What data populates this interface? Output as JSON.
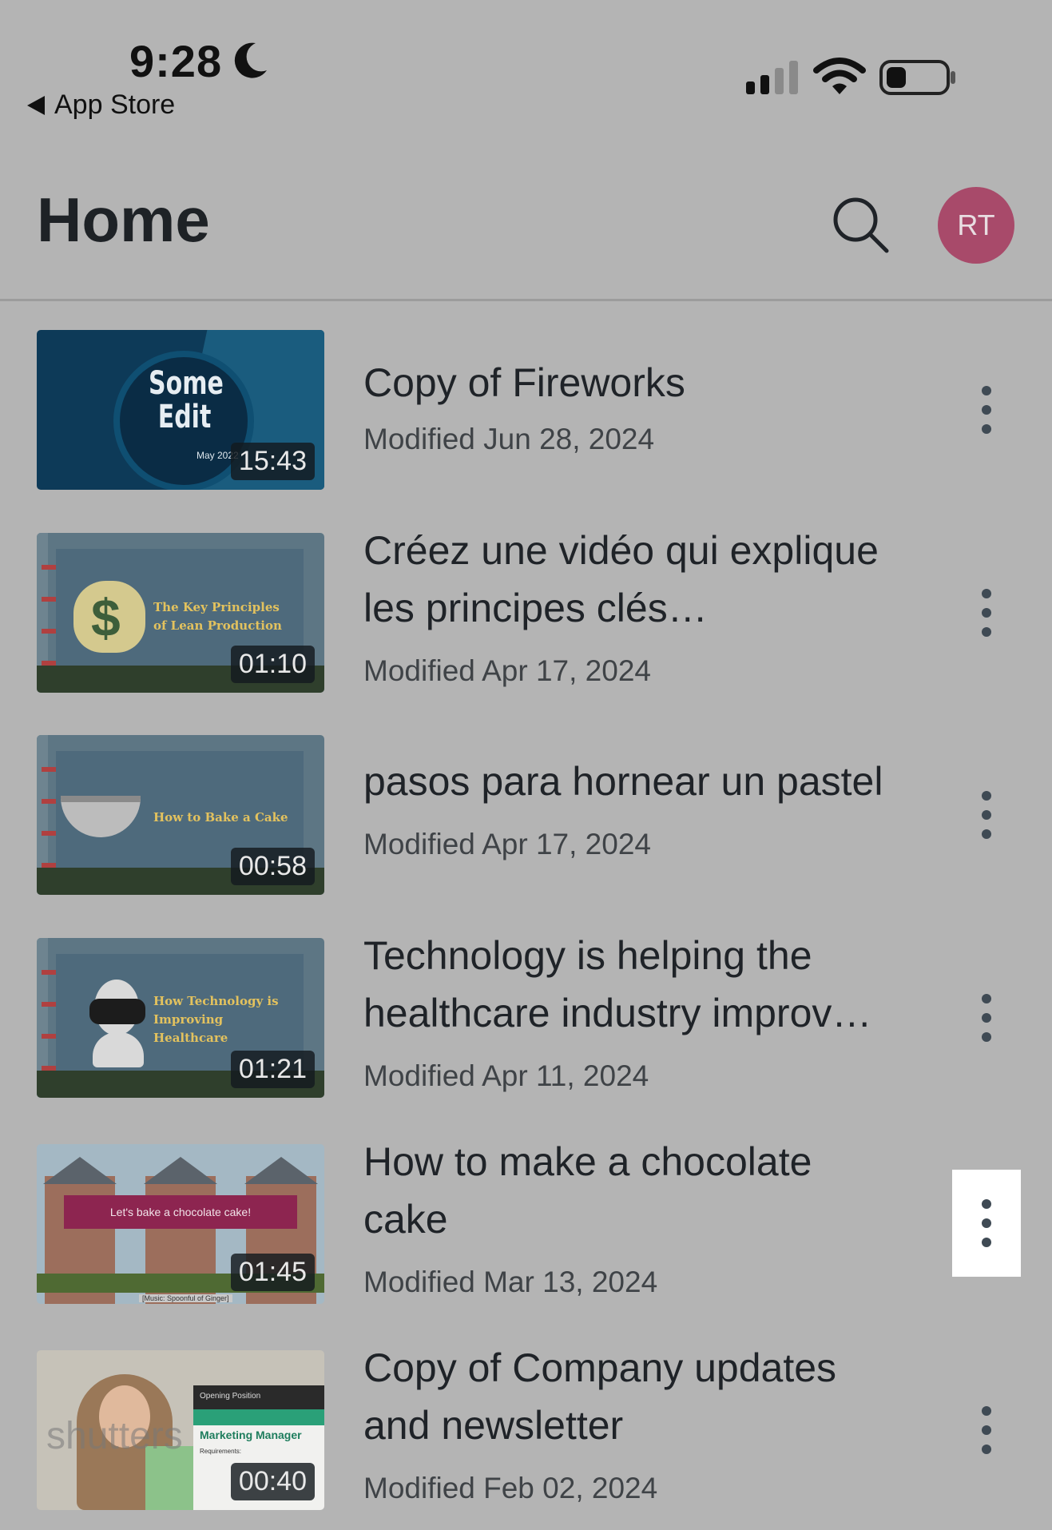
{
  "status_bar": {
    "time": "9:28",
    "back_label": "App Store",
    "icons": [
      "moon-icon",
      "cellular-signal-icon",
      "wifi-icon",
      "battery-icon"
    ]
  },
  "header": {
    "title": "Home",
    "avatar_initials": "RT"
  },
  "colors": {
    "background": "#b4b4b4",
    "avatar": "#a84a6a",
    "highlight": "#ffffff"
  },
  "videos": [
    {
      "title": "Copy of Fireworks",
      "modified": "Modified Jun 28, 2024",
      "duration": "15:43",
      "thumb_text": "Some Edit",
      "thumb_subtext": "May 2022"
    },
    {
      "title": "Créez une vidéo qui explique les principes clés…",
      "modified": "Modified Apr 17, 2024",
      "duration": "01:10",
      "thumb_text_1": "The Key Principles",
      "thumb_text_2": "of Lean Production"
    },
    {
      "title": "pasos para hornear un pastel",
      "modified": "Modified Apr 17, 2024",
      "duration": "00:58",
      "thumb_text": "How to Bake a Cake"
    },
    {
      "title": "Technology is helping the healthcare industry improv…",
      "modified": "Modified Apr 11, 2024",
      "duration": "01:21",
      "thumb_text_1": "How Technology is",
      "thumb_text_2": "Improving",
      "thumb_text_3": "Healthcare"
    },
    {
      "title": "How to make a chocolate cake",
      "modified": "Modified Mar 13, 2024",
      "duration": "01:45",
      "thumb_text": "Let's bake a chocolate cake!",
      "thumb_caption": "[Music: Spoonful of Ginger]"
    },
    {
      "title": "Copy of Company updates and newsletter",
      "modified": "Modified Feb 02, 2024",
      "duration": "00:40",
      "thumb_text_1": "Opening Position",
      "thumb_text_2": "Marketing Manager",
      "thumb_text_3": "Requirements:",
      "thumb_text_4": "shutters"
    }
  ]
}
